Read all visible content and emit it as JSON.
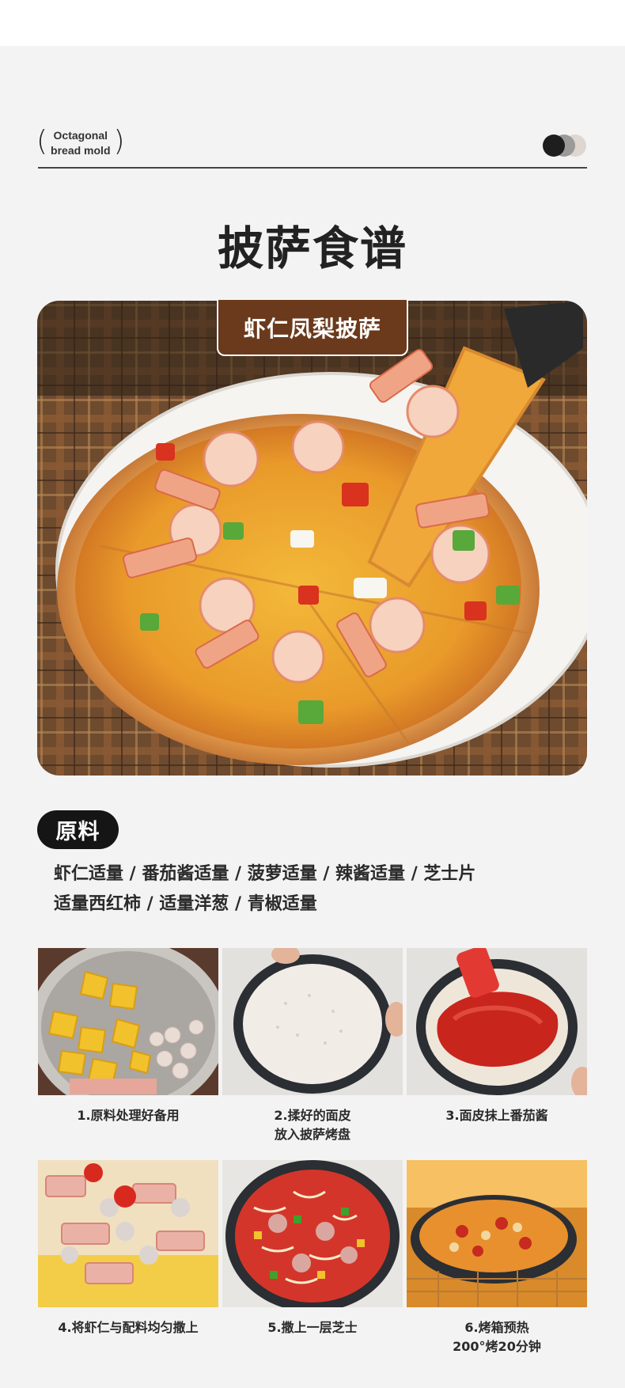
{
  "brand": {
    "line1": "Octagonal",
    "line2": "bread mold"
  },
  "title": "披萨食谱",
  "hero": {
    "ribbon": "虾仁凤梨披萨"
  },
  "ingredients": {
    "heading": "原料",
    "line1": "虾仁适量 / 番茄酱适量 / 菠萝适量 / 辣酱适量 / 芝士片",
    "line2": "适量西红柿 / 适量洋葱 / 青椒适量"
  },
  "steps": [
    {
      "line1": "1.原料处理好备用",
      "line2": ""
    },
    {
      "line1": "2.揉好的面皮",
      "line2": "放入披萨烤盘"
    },
    {
      "line1": "3.面皮抹上番茄酱",
      "line2": ""
    },
    {
      "line1": "4.将虾仁与配料均匀撒上",
      "line2": ""
    },
    {
      "line1": "5.撒上一层芝士",
      "line2": ""
    },
    {
      "line1": "6.烤箱预热",
      "line2": "200°烤20分钟"
    }
  ],
  "colors": {
    "ribbon": "#6b3a1c",
    "pill": "#151515",
    "background": "#f3f3f3"
  }
}
